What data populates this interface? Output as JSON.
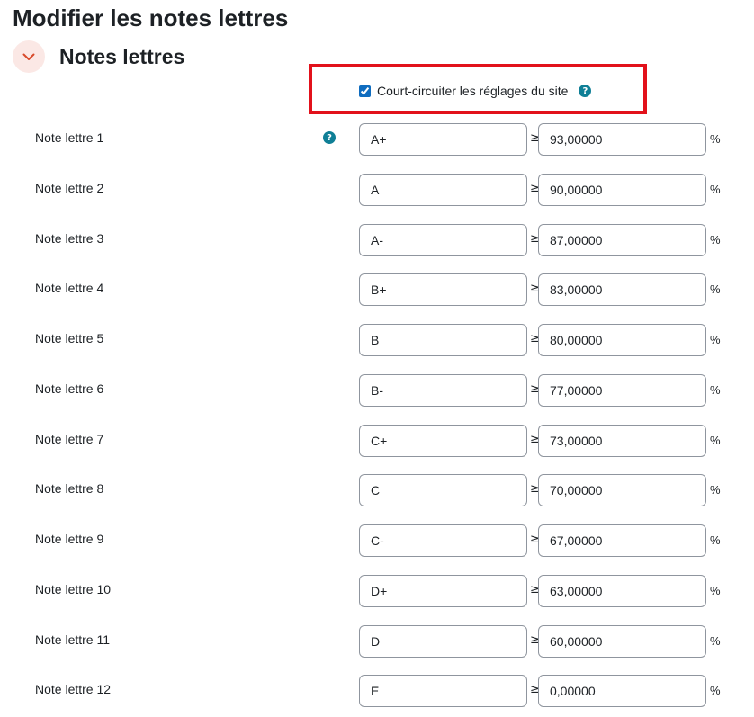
{
  "page": {
    "title": "Modifier les notes lettres"
  },
  "section": {
    "title": "Notes lettres",
    "toggle_icon": "chevron-down-icon",
    "accent_color": "#d84a2b"
  },
  "override": {
    "label": "Court-circuiter les réglages du site",
    "checked": true,
    "help_icon": "question-mark-icon",
    "highlight_color": "#e2111b"
  },
  "help_glyph": "?",
  "ge_symbol": "≥",
  "percent_symbol": "%",
  "grades": [
    {
      "label": "Note lettre 1",
      "letter": "A+",
      "bound": "93,00000"
    },
    {
      "label": "Note lettre 2",
      "letter": "A",
      "bound": "90,00000"
    },
    {
      "label": "Note lettre 3",
      "letter": "A-",
      "bound": "87,00000"
    },
    {
      "label": "Note lettre 4",
      "letter": "B+",
      "bound": "83,00000"
    },
    {
      "label": "Note lettre 5",
      "letter": "B",
      "bound": "80,00000"
    },
    {
      "label": "Note lettre 6",
      "letter": "B-",
      "bound": "77,00000"
    },
    {
      "label": "Note lettre 7",
      "letter": "C+",
      "bound": "73,00000"
    },
    {
      "label": "Note lettre 8",
      "letter": "C",
      "bound": "70,00000"
    },
    {
      "label": "Note lettre 9",
      "letter": "C-",
      "bound": "67,00000"
    },
    {
      "label": "Note lettre 10",
      "letter": "D+",
      "bound": "63,00000"
    },
    {
      "label": "Note lettre 11",
      "letter": "D",
      "bound": "60,00000"
    },
    {
      "label": "Note lettre 12",
      "letter": "E",
      "bound": "0,00000"
    }
  ]
}
